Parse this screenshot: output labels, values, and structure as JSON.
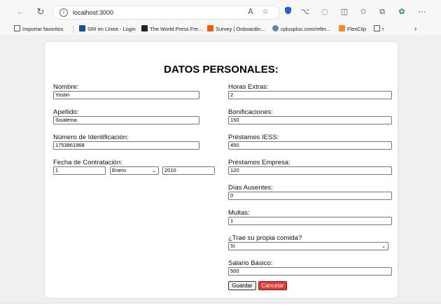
{
  "browser": {
    "url": "localhost:3000",
    "bookmarks": [
      {
        "label": "Importar favoritos",
        "icon_color": "#555555"
      },
      {
        "label": "SRI en Línea - Login",
        "icon_color": "#1a4f9c"
      },
      {
        "label": "The World Press Fre...",
        "icon_color": "#222222"
      },
      {
        "label": "Survey | Onboardin...",
        "icon_color": "#e85d04"
      },
      {
        "label": "cplusplus.com/refer...",
        "icon_color": "#6c7fb3"
      },
      {
        "label": "FlexClip",
        "icon_color": "#f28c28"
      },
      {
        "label": "r",
        "icon_color": "#555555"
      }
    ]
  },
  "form": {
    "title": "DATOS PERSONALES:",
    "left": {
      "nombre_label": "Nombre:",
      "nombre_value": "Yostin",
      "apellido_label": "Apellido:",
      "apellido_value": "Sisalema",
      "identificacion_label": "Número de Identificación:",
      "identificacion_value": "1753861968",
      "fecha_label": "Fecha de Contratación:",
      "fecha_dia": "1",
      "fecha_mes": "Enero",
      "fecha_anio": "2010"
    },
    "right": {
      "horas_label": "Horas Extras:",
      "horas_value": "2",
      "bonificaciones_label": "Bonificaciones:",
      "bonificaciones_value": "150",
      "prestamos_iess_label": "Préstamos IESS:",
      "prestamos_iess_value": "450",
      "prestamos_empresa_label": "Préstamos Empresa:",
      "prestamos_empresa_value": "120",
      "dias_label": "Días Ausentes:",
      "dias_value": "0",
      "multas_label": "Multas:",
      "multas_value": "1",
      "comida_label": "¿Trae su propia comida?",
      "comida_value": "Sí",
      "salario_label": "Salario Básico:",
      "salario_value": "500"
    },
    "save_label": "Guardar",
    "cancel_label": "Cancelar"
  }
}
